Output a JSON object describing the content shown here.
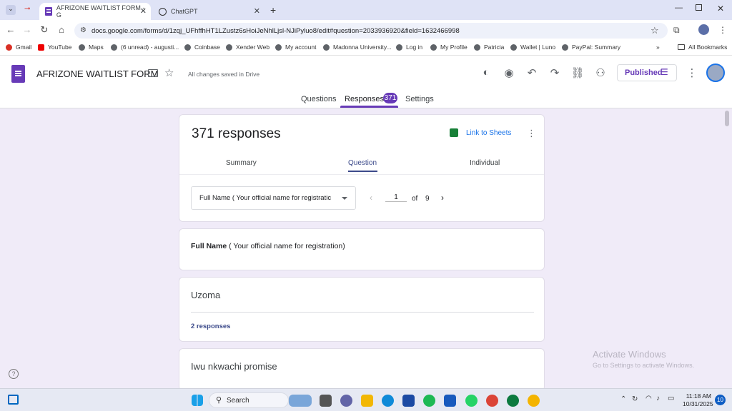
{
  "browser": {
    "tabs": [
      {
        "title": "AFRIZONE WAITLIST FORM - G"
      },
      {
        "title": "ChatGPT"
      }
    ],
    "url": "docs.google.com/forms/d/1zqj_UFhffhHT1LZustz6sHoiJeNhlLjsl-NJiPyluo8/edit#question=2033936920&field=1632466998",
    "bookmarks": [
      "Gmail",
      "YouTube",
      "Maps",
      "(6 unread) - augusti...",
      "Coinbase",
      "Xender Web",
      "My account",
      "Madonna University...",
      "Log in",
      "My Profile",
      "Patricia",
      "Wallet | Luno",
      "PayPal: Summary"
    ],
    "all_bookmarks": "All Bookmarks"
  },
  "header": {
    "title": "AFRIZONE WAITLIST FORM",
    "save_status": "All changes saved in Drive",
    "publish_label": "Published"
  },
  "form_tabs": {
    "questions": "Questions",
    "responses": "Responses",
    "responses_count": "371",
    "settings": "Settings"
  },
  "responses_card": {
    "heading": "371 responses",
    "link_sheets": "Link to Sheets",
    "subtabs": {
      "summary": "Summary",
      "question": "Question",
      "individual": "Individual"
    },
    "question_select": "Full Name ( Your official name for registratic",
    "pager": {
      "current": "1",
      "of_label": "of",
      "total": "9"
    }
  },
  "question_card": {
    "bold": "Full Name",
    "rest": " ( Your official name for registration)"
  },
  "answers": [
    {
      "value": "Uzoma",
      "count_label": "2 responses"
    },
    {
      "value": "Iwu nkwachi promise"
    }
  ],
  "watermark": {
    "title": "Activate Windows",
    "subtitle": "Go to Settings to activate Windows."
  },
  "taskbar": {
    "search": "Search",
    "time": "11:18 AM",
    "date": "10/31/2025",
    "notifications": "10"
  }
}
